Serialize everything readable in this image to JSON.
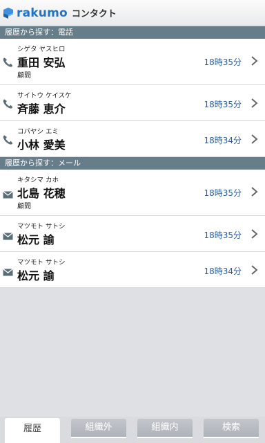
{
  "header": {
    "brand": "rakumo",
    "title": "コンタクト"
  },
  "sections": {
    "phone": {
      "label": "履歴から探す：電話"
    },
    "mail": {
      "label": "履歴から探す：メール"
    }
  },
  "phone_items": [
    {
      "kana": "シゲタ ヤスヒロ",
      "name": "重田 安弘",
      "role": "顧問",
      "time": "18時35分"
    },
    {
      "kana": "サイトウ ケイスケ",
      "name": "斉藤 恵介",
      "role": "",
      "time": "18時35分"
    },
    {
      "kana": "コバヤシ エミ",
      "name": "小林 愛美",
      "role": "",
      "time": "18時34分"
    }
  ],
  "mail_items": [
    {
      "kana": "キタシマ カホ",
      "name": "北島 花穂",
      "role": "顧問",
      "time": "18時35分"
    },
    {
      "kana": "マツモト サトシ",
      "name": "松元 諭",
      "role": "",
      "time": "18時35分"
    },
    {
      "kana": "マツモト サトシ",
      "name": "松元 諭",
      "role": "",
      "time": "18時34分"
    }
  ],
  "tabs": [
    {
      "label": "履歴",
      "active": true
    },
    {
      "label": "組織外",
      "active": false
    },
    {
      "label": "組織内",
      "active": false
    },
    {
      "label": "検索",
      "active": false
    }
  ],
  "colors": {
    "brand": "#1f74c6",
    "section_bar": "#667e8a",
    "time_text": "#2a5e9e",
    "icon": "#5a6e78"
  },
  "icons": {
    "logo": "rakumo-logo-mark",
    "phone": "phone-icon",
    "mail": "mail-icon",
    "chevron": "chevron-right-icon"
  }
}
